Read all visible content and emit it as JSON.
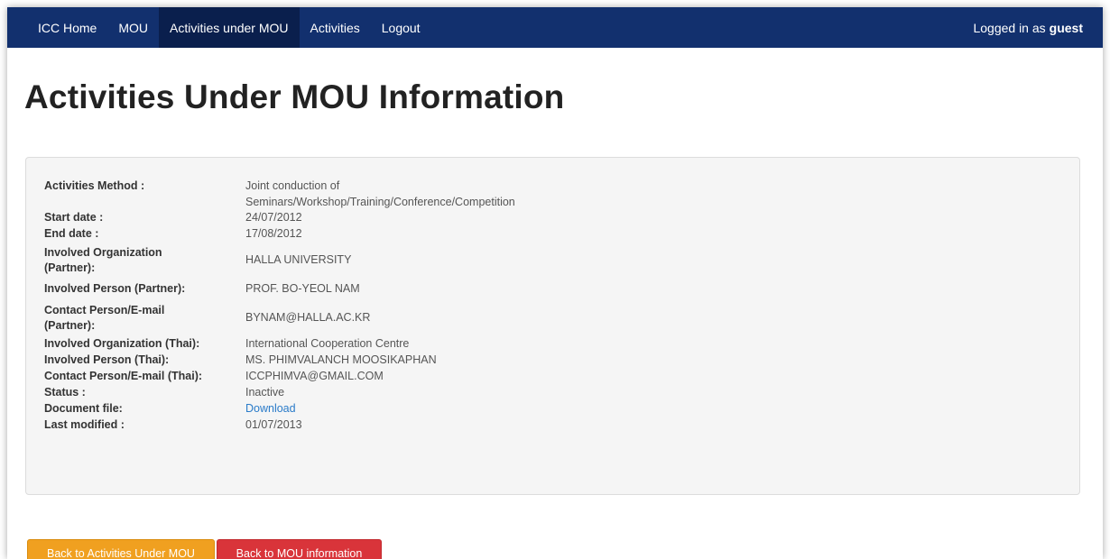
{
  "nav": {
    "items": [
      {
        "label": "ICC Home"
      },
      {
        "label": "MOU"
      },
      {
        "label": "Activities under MOU"
      },
      {
        "label": "Activities"
      },
      {
        "label": "Logout"
      }
    ],
    "active_index": 2,
    "logged_in_prefix": "Logged in as",
    "logged_in_user": "guest"
  },
  "page": {
    "title": "Activities Under MOU Information"
  },
  "details": [
    {
      "label": "Activities Method :",
      "value": "Joint conduction of Seminars/Workshop/Training/Conference/Competition"
    },
    {
      "label": "Start date :",
      "value": "24/07/2012"
    },
    {
      "label": "End date :",
      "value": "17/08/2012"
    },
    {
      "label": "Involved Organization (Partner):",
      "value": "HALLA UNIVERSITY"
    },
    {
      "label": "Involved Person (Partner):",
      "value": "PROF. BO-YEOL NAM"
    },
    {
      "label": "Contact Person/E-mail (Partner):",
      "value": "BYNAM@HALLA.AC.KR"
    },
    {
      "label": "Involved Organization (Thai):",
      "value": "International Cooperation Centre"
    },
    {
      "label": "Involved Person (Thai):",
      "value": "MS. PHIMVALANCH MOOSIKAPHAN"
    },
    {
      "label": "Contact Person/E-mail (Thai):",
      "value": "ICCPHIMVA@GMAIL.COM"
    },
    {
      "label": "Status :",
      "value": "Inactive"
    },
    {
      "label": "Document file:",
      "value": "Download"
    },
    {
      "label": "Last modified :",
      "value": "01/07/2013"
    }
  ],
  "buttons": {
    "back_activities": "Back to Activities Under MOU",
    "back_mou": "Back to MOU information"
  },
  "colors": {
    "navbar": "#12306e",
    "navbar_active": "#0a1f4d",
    "link": "#2a7bc9",
    "btn_orange": "#f0a020",
    "btn_red": "#d9343a"
  }
}
